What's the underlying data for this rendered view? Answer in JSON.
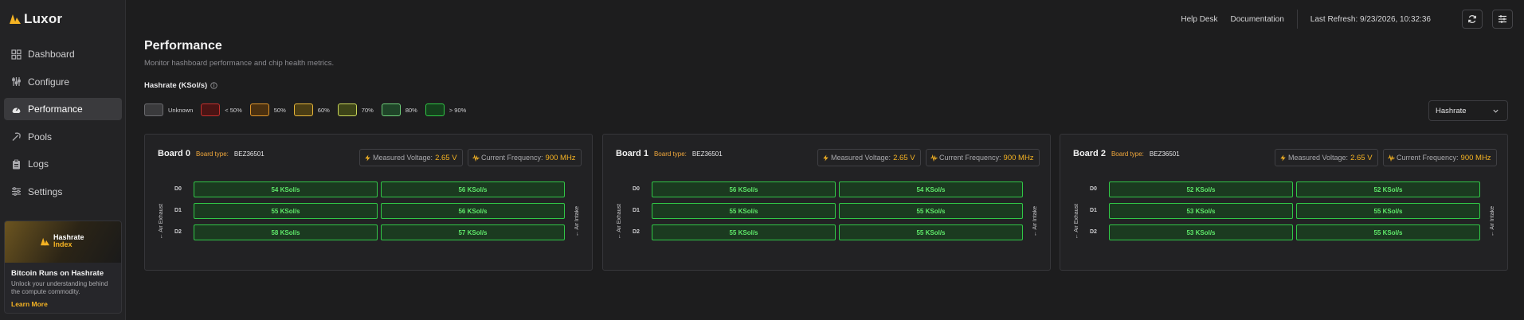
{
  "app": {
    "name": "Luxor"
  },
  "sidebar": {
    "items": [
      {
        "label": "Dashboard",
        "icon": "dashboard-grid-icon",
        "active": false
      },
      {
        "label": "Configure",
        "icon": "sliders-icon",
        "active": false
      },
      {
        "label": "Performance",
        "icon": "gauge-icon",
        "active": true
      },
      {
        "label": "Pools",
        "icon": "pickaxe-icon",
        "active": false
      },
      {
        "label": "Logs",
        "icon": "clipboard-icon",
        "active": false
      },
      {
        "label": "Settings",
        "icon": "settings-sliders-icon",
        "active": false
      }
    ],
    "promo": {
      "banner_line1": "Hashrate",
      "banner_line2": "Index",
      "title": "Bitcoin Runs on Hashrate",
      "description": "Unlock your understanding behind the compute commodity.",
      "link": "Learn More"
    }
  },
  "header": {
    "help_desk": "Help Desk",
    "documentation": "Documentation",
    "last_refresh": "Last Refresh: 9/23/2026, 10:32:36"
  },
  "page": {
    "title": "Performance",
    "subtitle": "Monitor hashboard performance and chip health metrics.",
    "section_label": "Hashrate (KSol/s)",
    "metric_select": "Hashrate"
  },
  "legend": [
    {
      "label": "Unknown",
      "fill": "#3a3a3c",
      "border": "#6b6b6f"
    },
    {
      "label": "< 50%",
      "fill": "#4a1414",
      "border": "#c2302d"
    },
    {
      "label": "50%",
      "fill": "#4a3010",
      "border": "#e0962a"
    },
    {
      "label": "60%",
      "fill": "#4a3d14",
      "border": "#e6b53a"
    },
    {
      "label": "70%",
      "fill": "#3d4418",
      "border": "#c9d65a"
    },
    {
      "label": "80%",
      "fill": "#1f4428",
      "border": "#6fcf7a"
    },
    {
      "label": "> 90%",
      "fill": "#14401c",
      "border": "#2fc744"
    }
  ],
  "colors": {
    "accent": "#f5b323",
    "chip_ok_border": "#31c747",
    "chip_ok_text": "#5fe86a"
  },
  "board_labels": {
    "type_label": "Board type:",
    "voltage_label": "Measured Voltage:",
    "frequency_label": "Current Frequency:",
    "exhaust": "Air Exhaust",
    "intake": "Air Intake"
  },
  "boards": [
    {
      "title": "Board 0",
      "type": "BEZ36501",
      "voltage": "2.65 V",
      "frequency": "900 MHz",
      "rows": [
        {
          "label": "D0",
          "chips": [
            "54 KSol/s",
            "56 KSol/s"
          ]
        },
        {
          "label": "D1",
          "chips": [
            "55 KSol/s",
            "56 KSol/s"
          ]
        },
        {
          "label": "D2",
          "chips": [
            "58 KSol/s",
            "57 KSol/s"
          ]
        }
      ]
    },
    {
      "title": "Board 1",
      "type": "BEZ36501",
      "voltage": "2.65 V",
      "frequency": "900 MHz",
      "rows": [
        {
          "label": "D0",
          "chips": [
            "56 KSol/s",
            "54 KSol/s"
          ]
        },
        {
          "label": "D1",
          "chips": [
            "55 KSol/s",
            "55 KSol/s"
          ]
        },
        {
          "label": "D2",
          "chips": [
            "55 KSol/s",
            "55 KSol/s"
          ]
        }
      ]
    },
    {
      "title": "Board 2",
      "type": "BEZ36501",
      "voltage": "2.65 V",
      "frequency": "900 MHz",
      "rows": [
        {
          "label": "D0",
          "chips": [
            "52 KSol/s",
            "52 KSol/s"
          ]
        },
        {
          "label": "D1",
          "chips": [
            "53 KSol/s",
            "55 KSol/s"
          ]
        },
        {
          "label": "D2",
          "chips": [
            "53 KSol/s",
            "55 KSol/s"
          ]
        }
      ]
    }
  ]
}
